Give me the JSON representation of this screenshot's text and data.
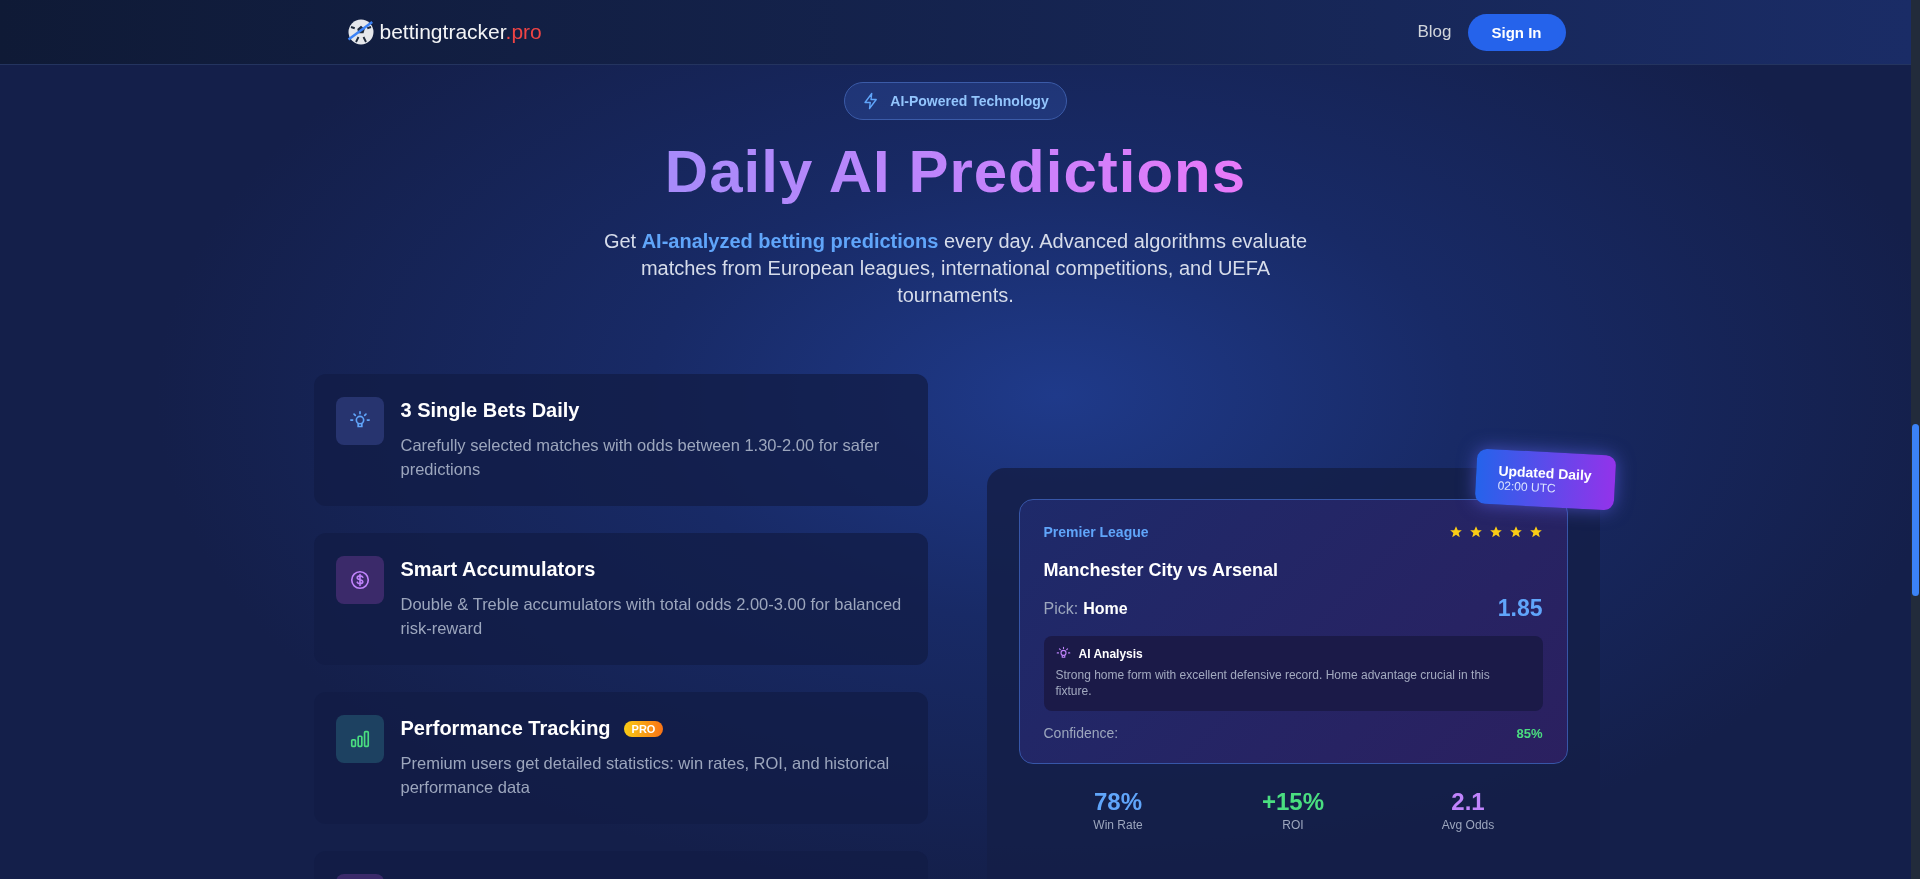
{
  "header": {
    "logo": {
      "name": "bettingtracker",
      "suffix": ".pro"
    },
    "nav": [
      {
        "label": "Blog",
        "kind": "link"
      },
      {
        "label": "Sign In",
        "kind": "button"
      }
    ]
  },
  "hero": {
    "badge": "AI-Powered Technology",
    "title": "Daily AI Predictions",
    "text": "Get **AI-analyzed betting predictions** every day. Advanced algorithms evaluate matches from European leagues, international competitions, and UEFA tournaments."
  },
  "features": [
    {
      "kind": "bulb",
      "title": "3 Single Bets Daily",
      "text": "Carefully selected matches with odds between 1.30-2.00 for safer predictions"
    },
    {
      "kind": "dollar",
      "title": "Smart Accumulators",
      "text": "Double & Treble accumulators with total odds 2.00-3.00 for balanced risk-reward"
    },
    {
      "kind": "chart",
      "title": "Performance Tracking",
      "tag": "PRO",
      "text": "Premium users get detailed statistics: win rates, ROI, and historical performance data"
    },
    {
      "kind": "partial"
    }
  ],
  "preview": {
    "ribbon": {
      "title": "Updated Daily",
      "time": "02:00 UTC"
    },
    "prediction": {
      "league": "Premier League",
      "stars": 5,
      "match": "Manchester City vs Arsenal",
      "pick_label": "Pick:",
      "pick": "Home",
      "odds": "1.85",
      "analysis_title": "AI Analysis",
      "analysis": "Strong home form with excellent defensive record. Home advantage crucial in this fixture.",
      "confidence_label": "Confidence:",
      "confidence": "85%"
    },
    "stats": [
      {
        "value": "78%",
        "label": "Win Rate",
        "color": "#60a5fa"
      },
      {
        "value": "+15%",
        "label": "ROI",
        "color": "#4ade80"
      },
      {
        "value": "2.1",
        "label": "Avg Odds",
        "color": "#c084fc"
      }
    ]
  }
}
